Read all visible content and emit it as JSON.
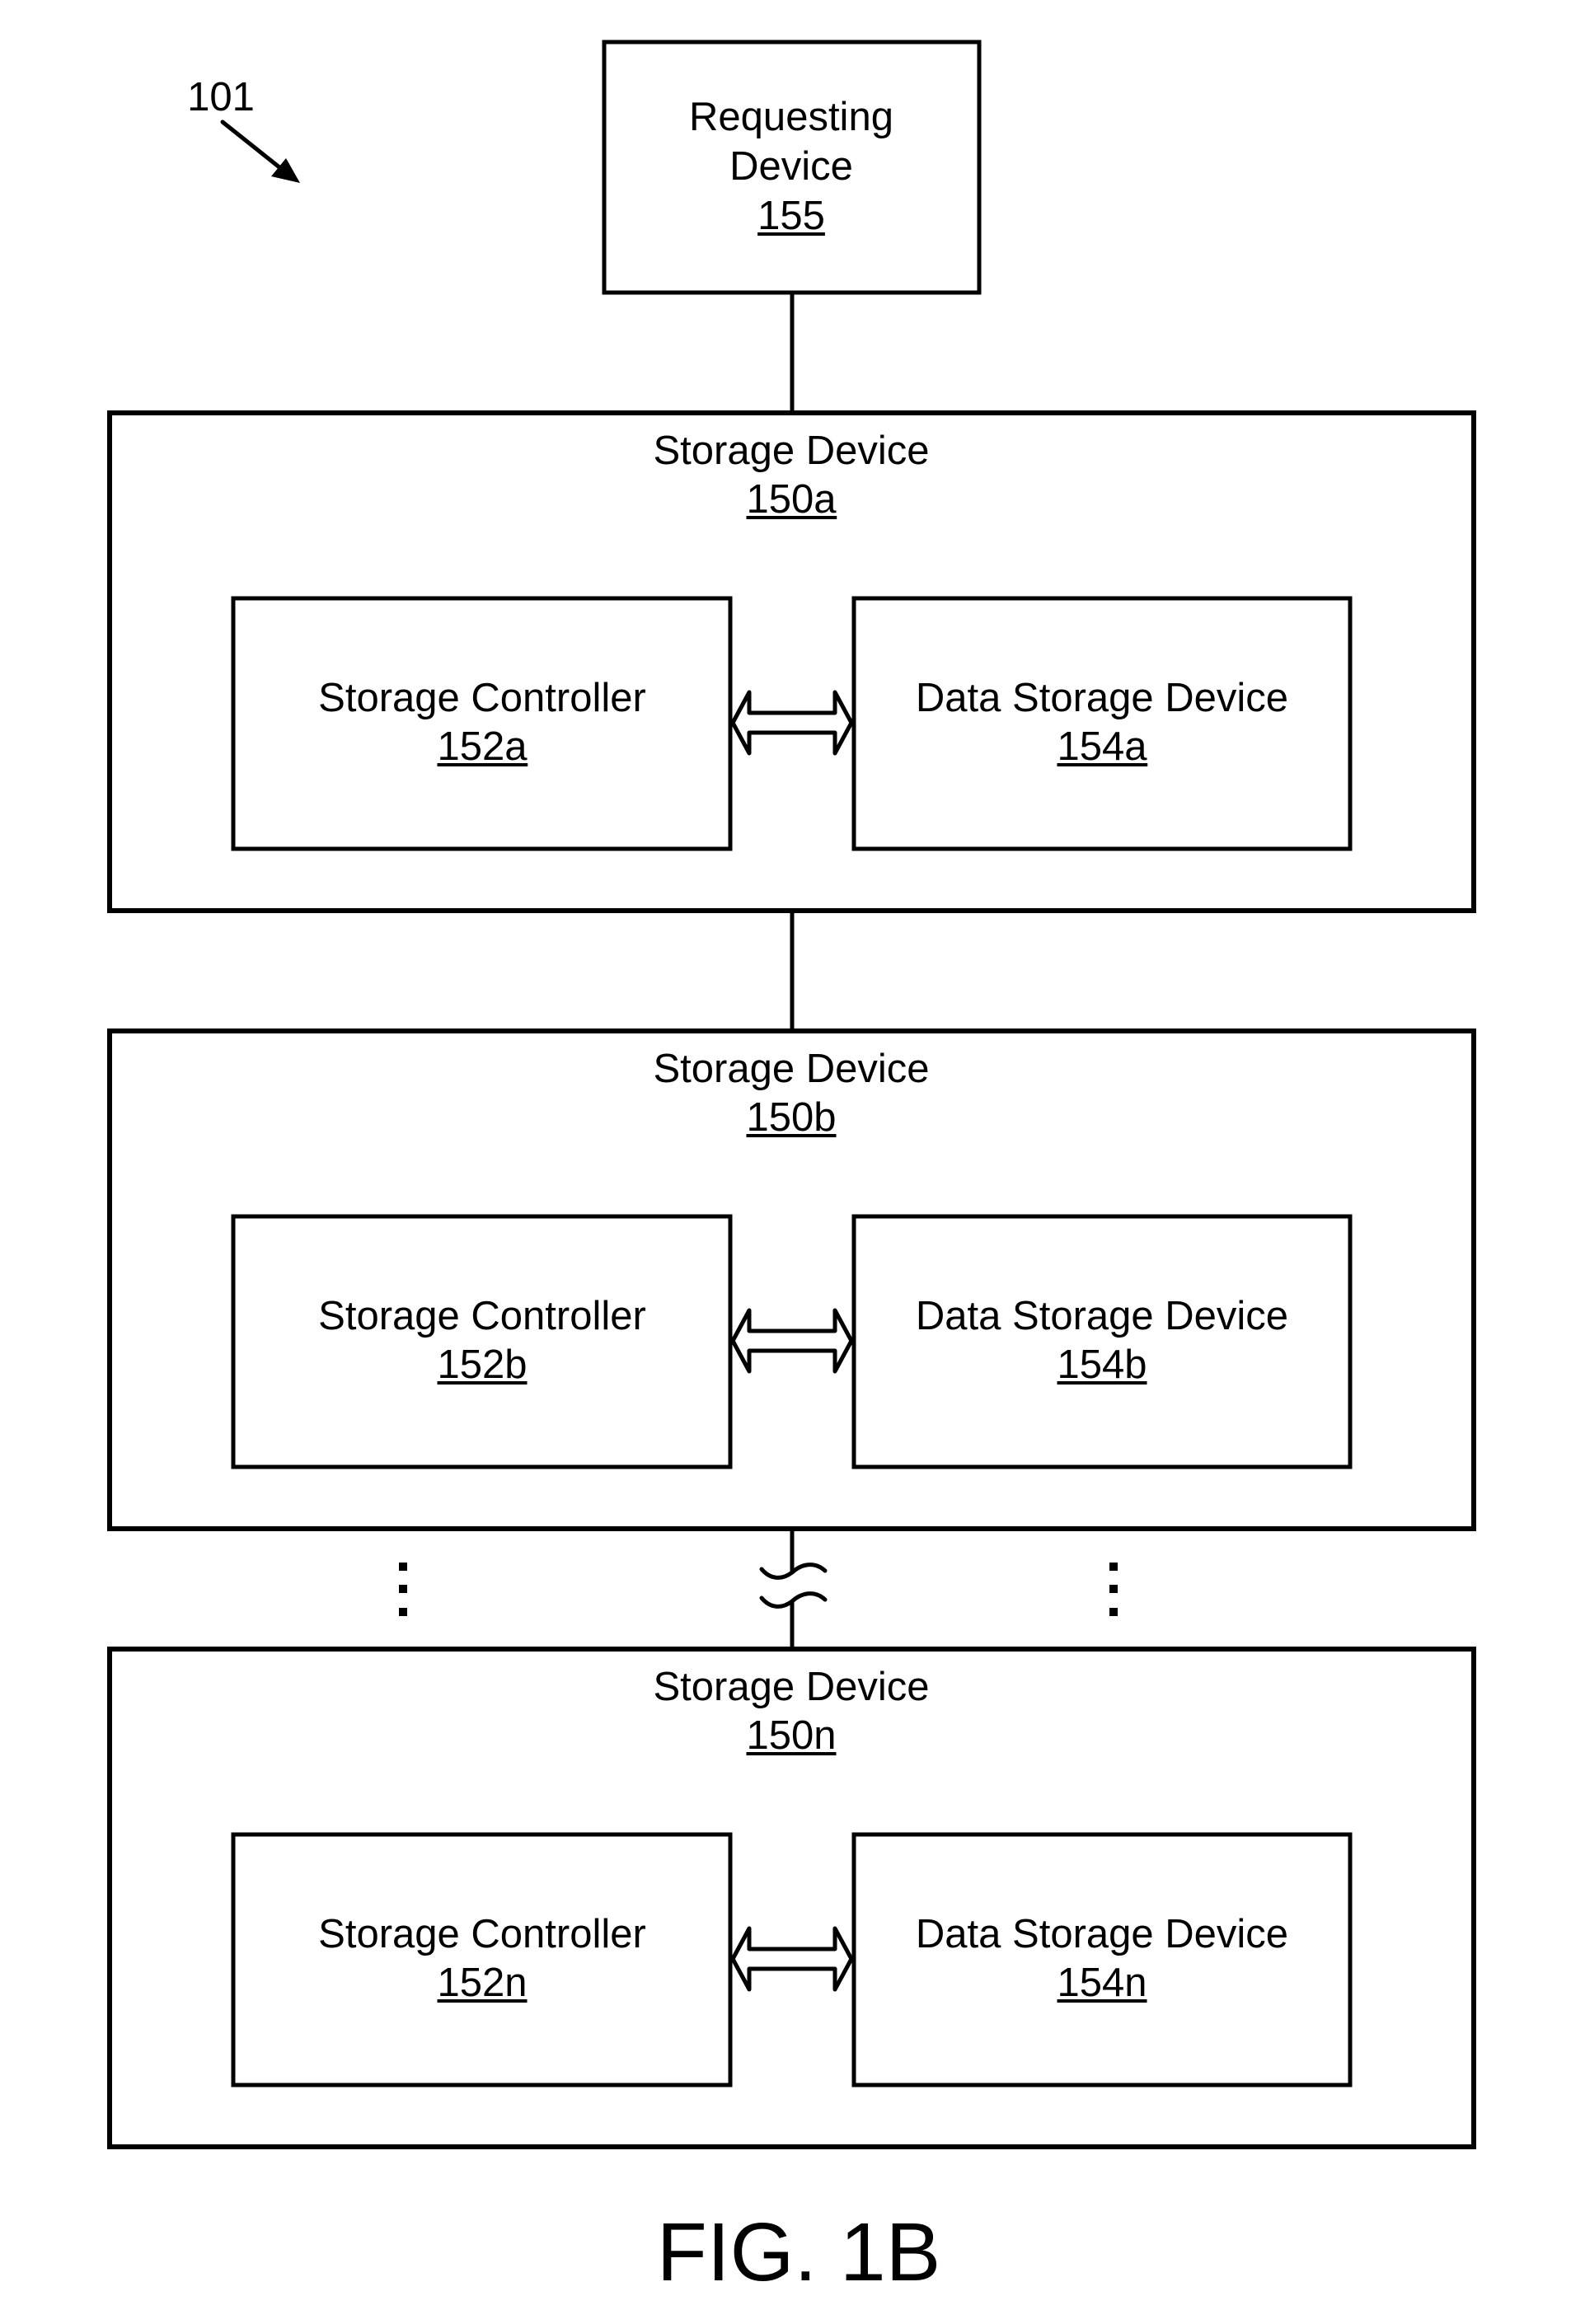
{
  "figure": {
    "reference_label": "101",
    "caption": "FIG. 1B"
  },
  "requesting_device": {
    "line1": "Requesting",
    "line2": "Device",
    "ref": "155"
  },
  "storage_devices": [
    {
      "title": "Storage Device",
      "ref": "150a",
      "controller": {
        "title": "Storage Controller",
        "ref": "152a"
      },
      "data_storage": {
        "title": "Data Storage Device",
        "ref": "154a"
      }
    },
    {
      "title": "Storage Device",
      "ref": "150b",
      "controller": {
        "title": "Storage Controller",
        "ref": "152b"
      },
      "data_storage": {
        "title": "Data Storage Device",
        "ref": "154b"
      }
    },
    {
      "title": "Storage Device",
      "ref": "150n",
      "controller": {
        "title": "Storage Controller",
        "ref": "152n"
      },
      "data_storage": {
        "title": "Data Storage Device",
        "ref": "154n"
      }
    }
  ],
  "icons": {
    "reference_arrow": "arrow-down-right-icon",
    "bidirectional_arrow": "double-arrow-icon",
    "line_break": "wavy-break-icon",
    "continuation": "vertical-ellipsis-icon"
  }
}
